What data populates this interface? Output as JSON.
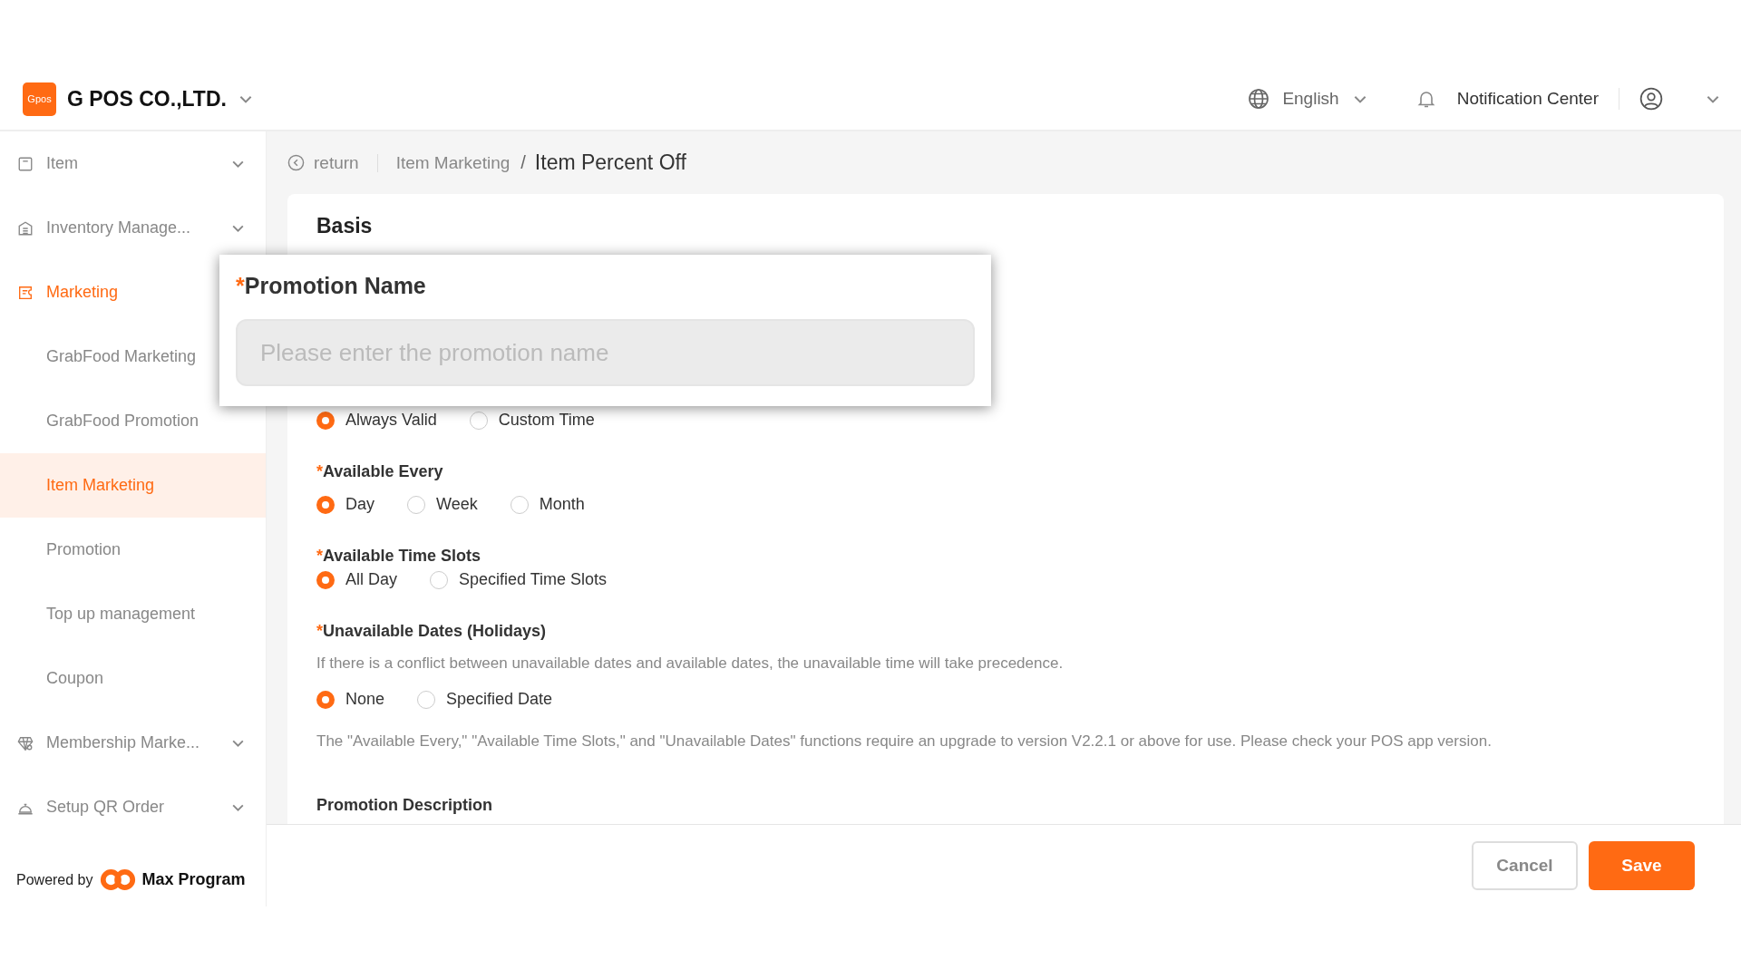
{
  "header": {
    "logo_text": "Gpos",
    "company": "G POS CO.,LTD.",
    "language": "English",
    "notification": "Notification Center"
  },
  "sidebar": {
    "items": [
      {
        "label": "Item",
        "expanded": false
      },
      {
        "label": "Inventory Manage...",
        "expanded": false
      },
      {
        "label": "Marketing",
        "expanded": true,
        "children": [
          {
            "label": "GrabFood Marketing",
            "selected": false
          },
          {
            "label": "GrabFood Promotion",
            "selected": false
          },
          {
            "label": "Item Marketing",
            "selected": true
          },
          {
            "label": "Promotion",
            "selected": false
          },
          {
            "label": "Top up management",
            "selected": false
          },
          {
            "label": "Coupon",
            "selected": false
          }
        ]
      },
      {
        "label": "Membership Marke...",
        "expanded": false
      },
      {
        "label": "Setup QR Order",
        "expanded": false
      }
    ],
    "powered_by": "Powered by",
    "brand": "Max Program"
  },
  "breadcrumb": {
    "back": "return",
    "parent": "Item Marketing",
    "separator": "/",
    "current": "Item Percent Off"
  },
  "form": {
    "section": "Basis",
    "popup": {
      "label": "Promotion Name",
      "required_mark": "*",
      "placeholder": "Please enter the promotion name"
    },
    "fields": [
      {
        "options": [
          {
            "label": "Always Valid",
            "selected": true
          },
          {
            "label": "Custom Time",
            "selected": false
          }
        ]
      },
      {
        "label": "Available Every",
        "required_mark": "*",
        "options": [
          {
            "label": "Day",
            "selected": true
          },
          {
            "label": "Week",
            "selected": false
          },
          {
            "label": "Month",
            "selected": false
          }
        ]
      },
      {
        "label": "Available Time Slots",
        "required_mark": "*",
        "options": [
          {
            "label": "All Day",
            "selected": true
          },
          {
            "label": "Specified Time Slots",
            "selected": false
          }
        ]
      },
      {
        "label": "Unavailable Dates (Holidays)",
        "required_mark": "*",
        "hint": "If there is a conflict between unavailable dates and available dates, the unavailable time will take precedence.",
        "options": [
          {
            "label": "None",
            "selected": true
          },
          {
            "label": "Specified Date",
            "selected": false
          }
        ]
      }
    ],
    "note": "The \"Available Every,\" \"Available Time Slots,\" and \"Unavailable Dates\" functions require an upgrade to version V2.2.1 or above for use. Please check your POS app version.",
    "description_label": "Promotion Description"
  },
  "footer": {
    "buttons": [
      {
        "label": "Cancel",
        "kind": "secondary"
      },
      {
        "label": "Save",
        "kind": "primary"
      }
    ]
  }
}
